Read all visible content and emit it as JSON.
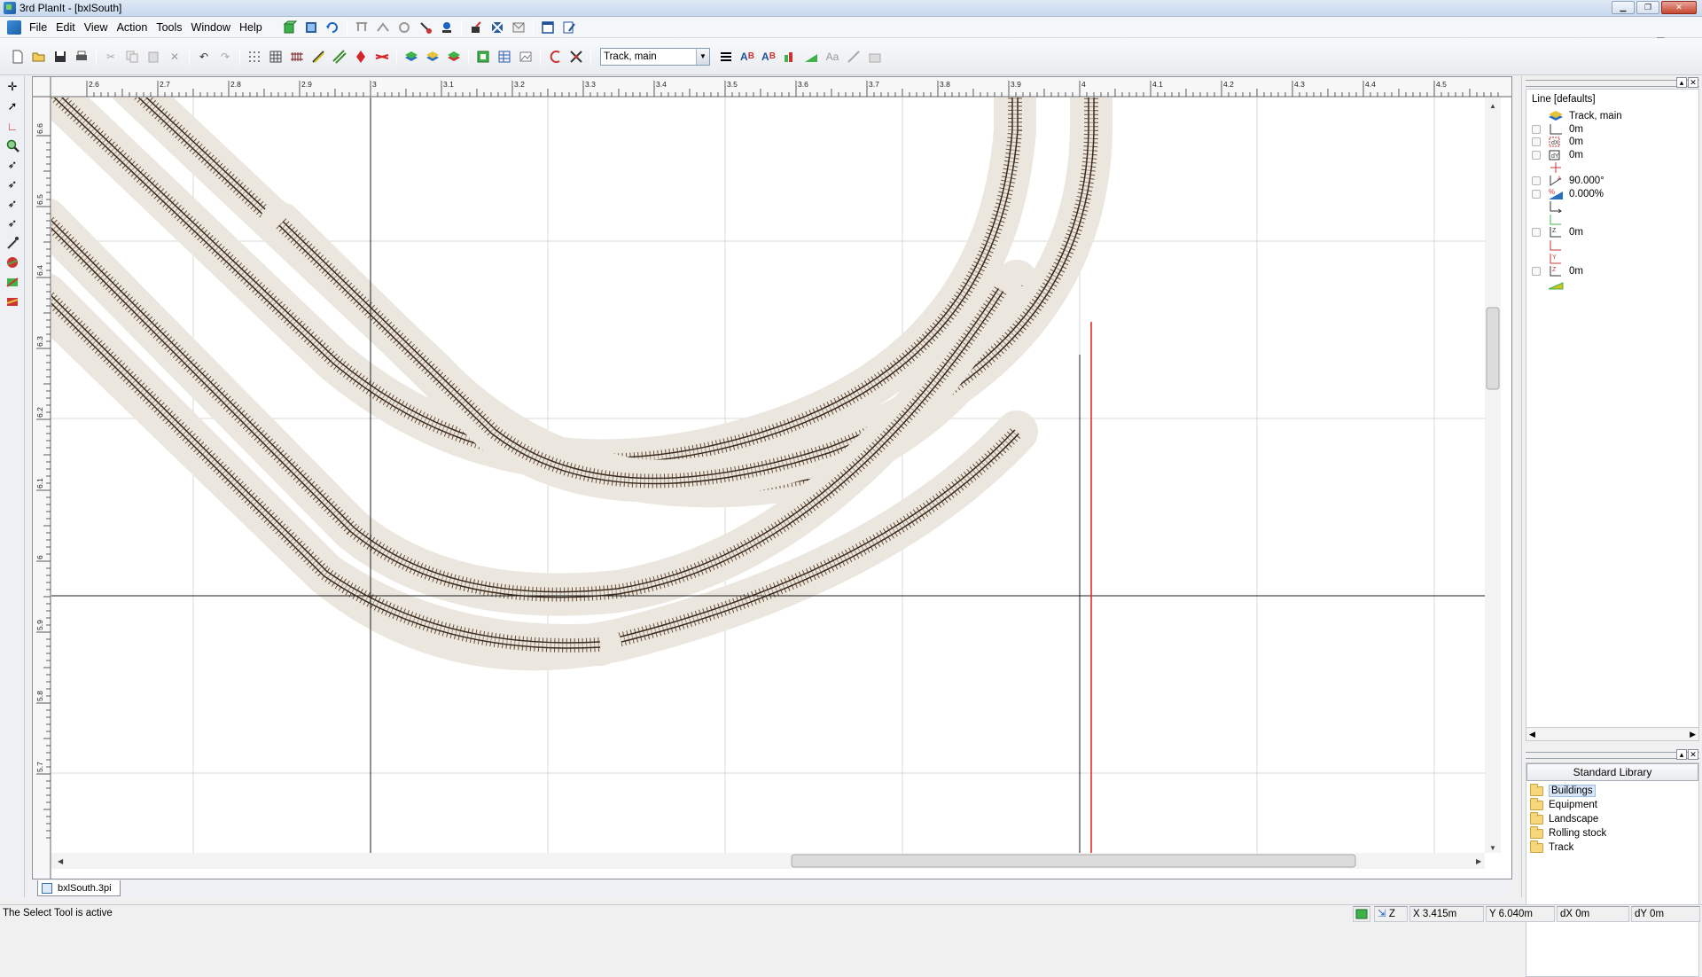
{
  "window": {
    "title": "3rd PlanIt - [bxlSouth]",
    "controls": {
      "minimize": "▁",
      "maximize": "❐",
      "close": "✕"
    }
  },
  "menubar": {
    "items": [
      "File",
      "Edit",
      "View",
      "Action",
      "Tools",
      "Window",
      "Help"
    ],
    "mdi_controls": {
      "minimize": "_",
      "restore": "❐",
      "close": "✕"
    }
  },
  "toolbar": {
    "layer_select_value": "Track, main"
  },
  "ruler": {
    "x_ticks": [
      "2.6",
      "2.7",
      "2.8",
      "2.9",
      "3",
      "3.1",
      "3.2",
      "3.3",
      "3.4",
      "3.5",
      "3.6",
      "3.7",
      "3.8",
      "3.9",
      "4",
      "4.1",
      "4.2",
      "4.3",
      "4.4",
      "4.5"
    ],
    "y_ticks": [
      "6.6",
      "6.5",
      "6.4",
      "6.3",
      "6.2",
      "6.1",
      "6",
      "5.9",
      "5.8",
      "5.7"
    ]
  },
  "properties_panel": {
    "header": "Line [defaults]",
    "rows": [
      {
        "icon": "track-layer-icon",
        "value": "Track, main"
      },
      {
        "icon": "length-icon",
        "value": "0m"
      },
      {
        "icon": "dx-icon",
        "value": "0m"
      },
      {
        "icon": "dy-icon",
        "value": "0m"
      },
      {
        "icon": "move-icon",
        "value": ""
      },
      {
        "icon": "angle-icon",
        "value": "90.000°"
      },
      {
        "icon": "grade-icon",
        "value": "0.000%"
      },
      {
        "icon": "x-axis-icon",
        "value": ""
      },
      {
        "icon": "y-axis-icon",
        "value": ""
      },
      {
        "icon": "z-start-icon",
        "value": "0m"
      },
      {
        "icon": "x-end-icon",
        "value": ""
      },
      {
        "icon": "y-end-icon",
        "value": ""
      },
      {
        "icon": "z-end-icon",
        "value": "0m"
      },
      {
        "icon": "ramp-icon",
        "value": ""
      }
    ]
  },
  "library_panel": {
    "title": "Standard Library",
    "folders": [
      "Buildings",
      "Equipment",
      "Landscape",
      "Rolling stock",
      "Track"
    ]
  },
  "document_tab": {
    "label": "bxlSouth.3pi"
  },
  "statusbar": {
    "message": "The Select Tool is active",
    "z_label": "Z",
    "x": "X 3.415m",
    "y": "Y 6.040m",
    "dx": "dX 0m",
    "dy": "dY 0m"
  },
  "colors": {
    "track_bed": "#ebe7df",
    "rail": "#3b2a1e",
    "ties": "#6a4c33",
    "grid": "#d8d8d8",
    "axis_line": "#1e1e1e",
    "cursor_guide": "#e02020"
  }
}
